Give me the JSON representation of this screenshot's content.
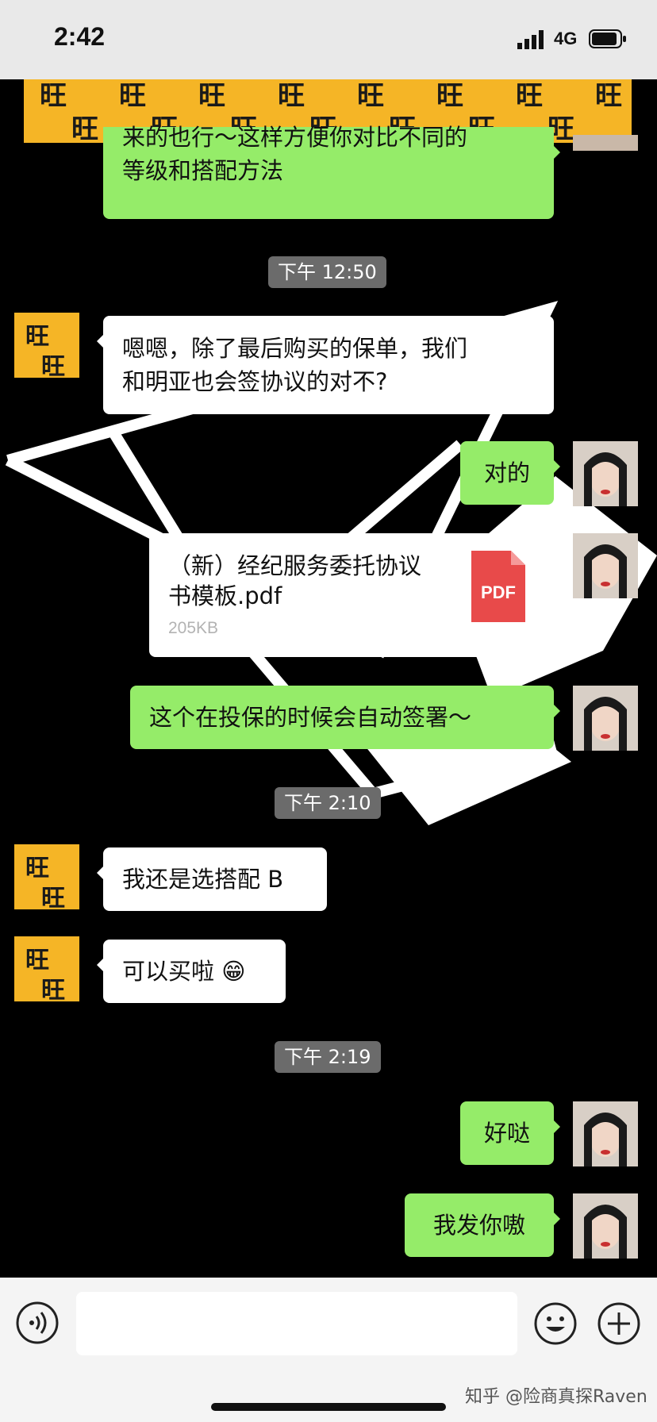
{
  "status_bar": {
    "time": "2:42",
    "network": "4G"
  },
  "banner": {
    "tile_char": "旺",
    "colors": {
      "bg": "#f5b526",
      "ink": "#1a1a1a"
    }
  },
  "colors": {
    "sent_bubble": "#95ec69",
    "received_bubble": "#ffffff",
    "timestamp_bg": "#6b6b6b",
    "pdf_red": "#e84a4a"
  },
  "messages": [
    {
      "type": "sent_partial",
      "text_line1": "来的也行～这样方便你对比不同的",
      "text_line2": "等级和搭配方法"
    },
    {
      "type": "timestamp",
      "text": "下午 12:50"
    },
    {
      "type": "received",
      "text_line1": "嗯嗯，除了最后购买的保单，我们",
      "text_line2": "和明亚也会签协议的对不?"
    },
    {
      "type": "sent",
      "text": "对的"
    },
    {
      "type": "sent_file",
      "file_name": "（新）经纪服务委托协议书模板.pdf",
      "file_size": "205KB",
      "file_icon_label": "PDF"
    },
    {
      "type": "sent",
      "text": "这个在投保的时候会自动签署～"
    },
    {
      "type": "timestamp",
      "text": "下午 2:10"
    },
    {
      "type": "received",
      "text": "我还是选搭配 B"
    },
    {
      "type": "received",
      "text": "可以买啦",
      "emoji": "😁"
    },
    {
      "type": "timestamp",
      "text": "下午 2:19"
    },
    {
      "type": "sent",
      "text": "好哒"
    },
    {
      "type": "sent",
      "text": "我发你嗷"
    }
  ],
  "input_bar": {
    "placeholder": "",
    "watermark": "知乎 @险商真探Raven"
  },
  "icons": {
    "voice": "voice-icon",
    "emoji": "emoji-icon",
    "plus": "plus-icon"
  }
}
